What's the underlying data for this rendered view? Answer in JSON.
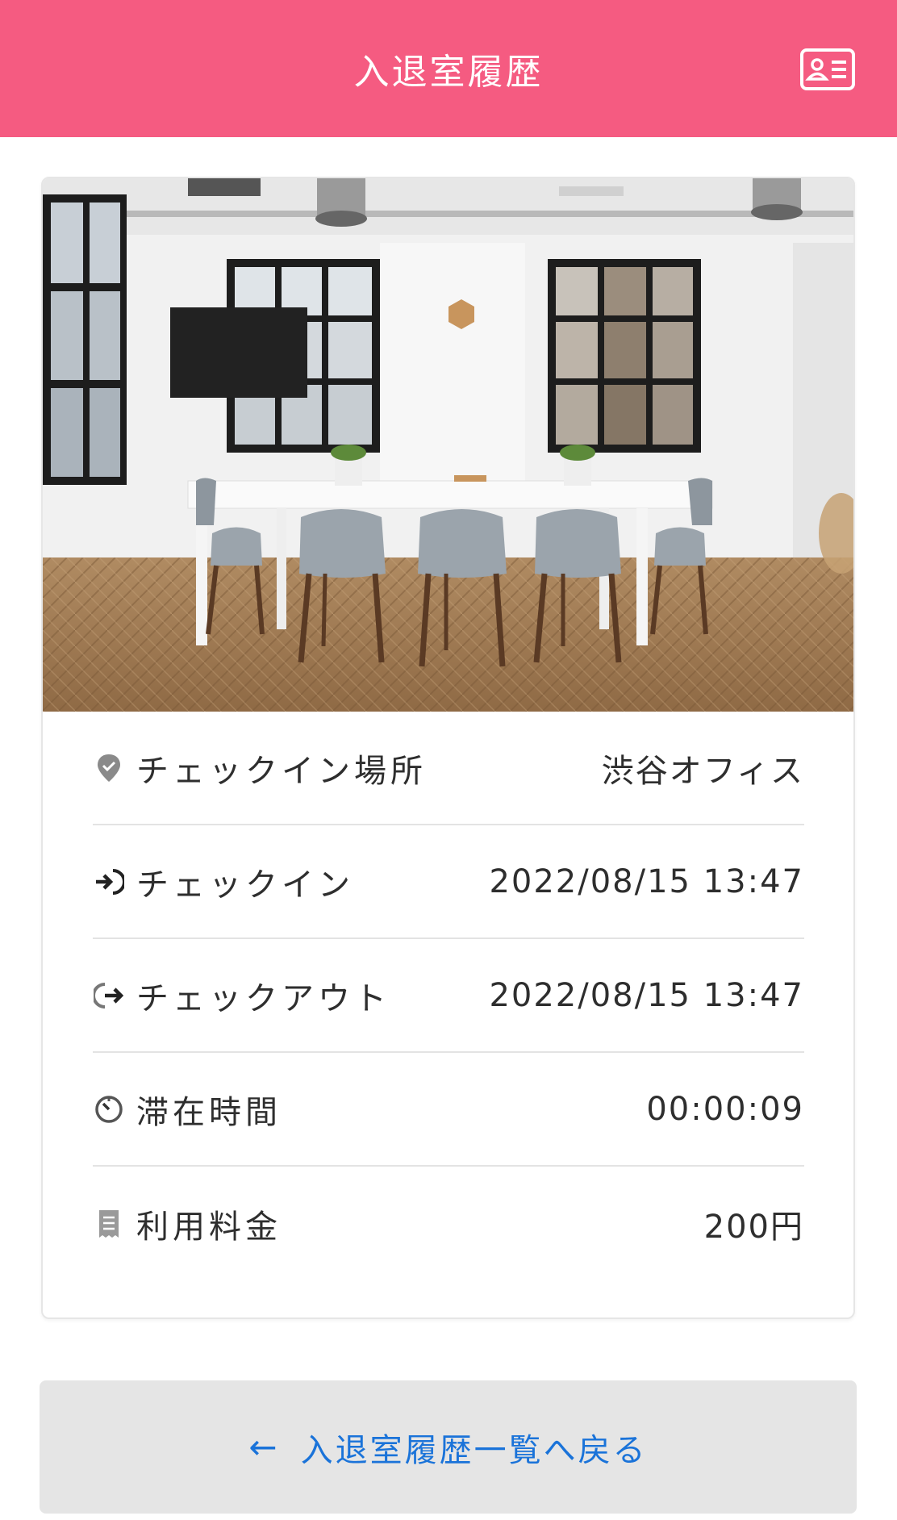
{
  "header": {
    "title": "入退室履歴",
    "card_icon": "id-card-icon"
  },
  "card": {
    "image_alt": "meeting-room-photo",
    "details": [
      {
        "icon": "location-pin-icon",
        "label": "チェックイン場所",
        "value": "渋谷オフィス"
      },
      {
        "icon": "sign-in-icon",
        "label": "チェックイン",
        "value": "2022/08/15 13:47"
      },
      {
        "icon": "sign-out-icon",
        "label": "チェックアウト",
        "value": "2022/08/15 13:47"
      },
      {
        "icon": "stopwatch-icon",
        "label": "滞在時間",
        "value": "00:00:09"
      },
      {
        "icon": "receipt-icon",
        "label": "利用料金",
        "value": "200円"
      }
    ]
  },
  "back_button": {
    "arrow": "←",
    "label": "入退室履歴一覧へ戻る"
  },
  "colors": {
    "header_bg": "#f55b81",
    "link_blue": "#1a73d9",
    "button_bg": "#e5e5e5"
  }
}
